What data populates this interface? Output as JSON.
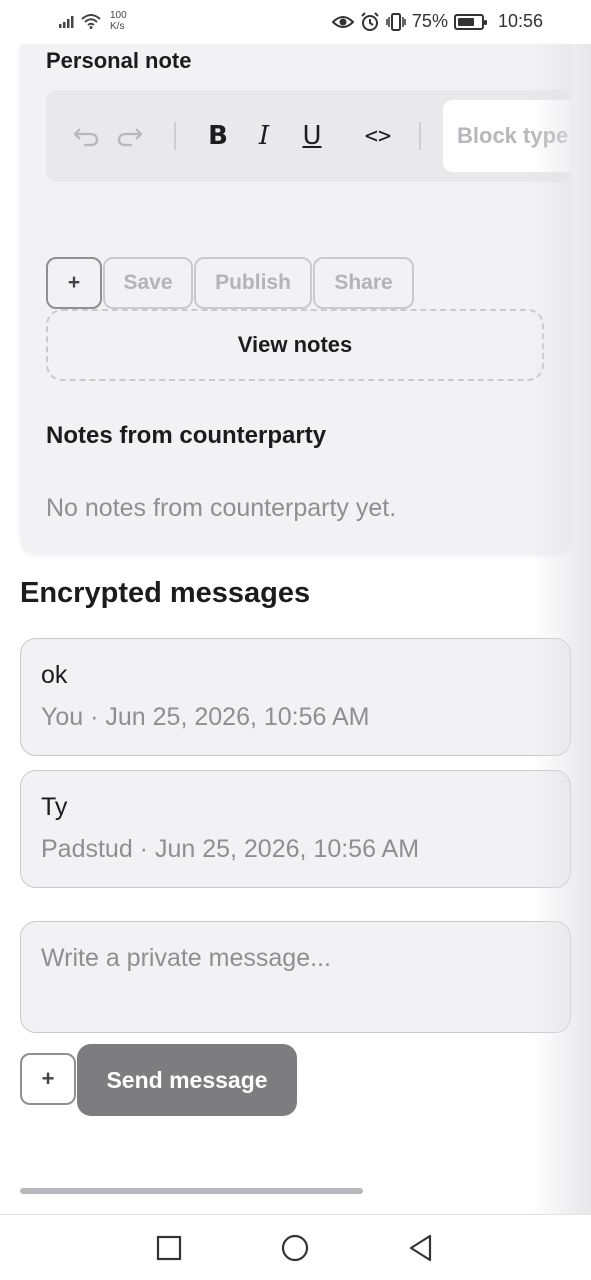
{
  "status_bar": {
    "speed_value": "100",
    "speed_unit": "K/s",
    "battery": "75%",
    "time": "10:56",
    "icons": [
      "signal-icon",
      "wifi-icon",
      "eye-icon",
      "alarm-icon",
      "vibrate-icon",
      "battery-icon"
    ]
  },
  "personal_note": {
    "title": "Personal note",
    "toolbar": {
      "bold": "B",
      "italic": "I",
      "underline": "U",
      "code": "<>",
      "block_type": "Block type"
    },
    "actions": {
      "add": "+",
      "save": "Save",
      "publish": "Publish",
      "share": "Share"
    },
    "view_notes": "View notes"
  },
  "counterparty": {
    "title": "Notes from counterparty",
    "empty": "No notes from counterparty yet."
  },
  "messages": {
    "title": "Encrypted messages",
    "items": [
      {
        "text": "ok",
        "meta": "You · Jun 25, 2026, 10:56 AM"
      },
      {
        "text": "Ty",
        "meta": "Padstud · Jun 25, 2026, 10:56 AM"
      }
    ]
  },
  "composer": {
    "placeholder": "Write a private message...",
    "add": "+",
    "send": "Send message"
  },
  "colors": {
    "card_bg": "#f2f2f4",
    "send_button": "#7d7d80",
    "muted_text": "#8e8e93"
  }
}
